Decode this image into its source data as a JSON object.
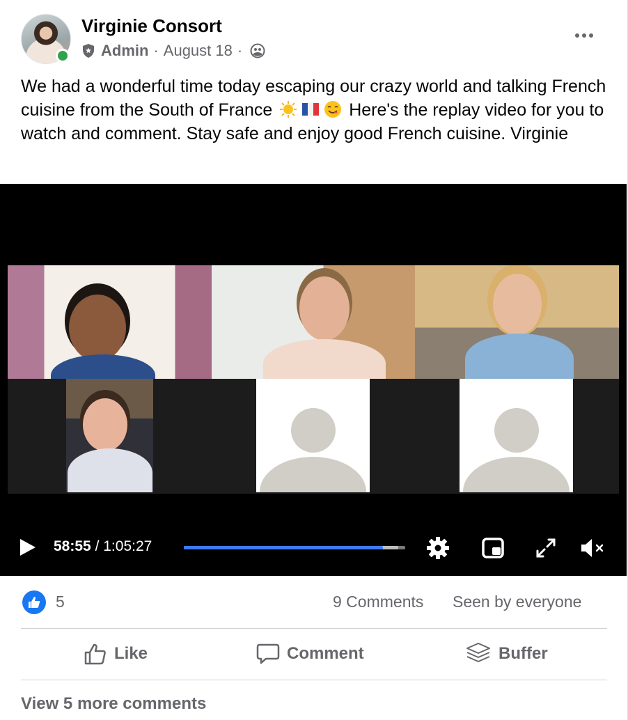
{
  "post": {
    "author": "Virginie Consort",
    "role": "Admin",
    "date": "August 18",
    "separator": "·",
    "privacy_icon": "globe-icon",
    "text_part1": "We had a wonderful time today escaping our crazy world and talking French cuisine from the South of France",
    "text_part2": "Here's the replay video for you to watch and comment. Stay safe and enjoy good French cuisine. Virginie",
    "emojis": [
      "sun",
      "france-flag",
      "yum-face"
    ]
  },
  "video": {
    "current_time": "58:55",
    "time_separator": "/",
    "duration": "1:05:27",
    "progress_fraction": 0.9,
    "buffered_fraction": 0.97,
    "controls": [
      "play-icon",
      "settings-icon",
      "picture-in-picture-icon",
      "fullscreen-icon",
      "muted-icon"
    ]
  },
  "footer": {
    "reactions": "5",
    "comments": "9 Comments",
    "seen": "Seen by everyone",
    "actions": {
      "like": "Like",
      "comment": "Comment",
      "buffer": "Buffer"
    },
    "view_more": "View 5 more comments"
  },
  "colors": {
    "accent": "#1877f2",
    "progress": "#3b7cf5",
    "online": "#31a24c",
    "secondary_text": "#65676b"
  }
}
